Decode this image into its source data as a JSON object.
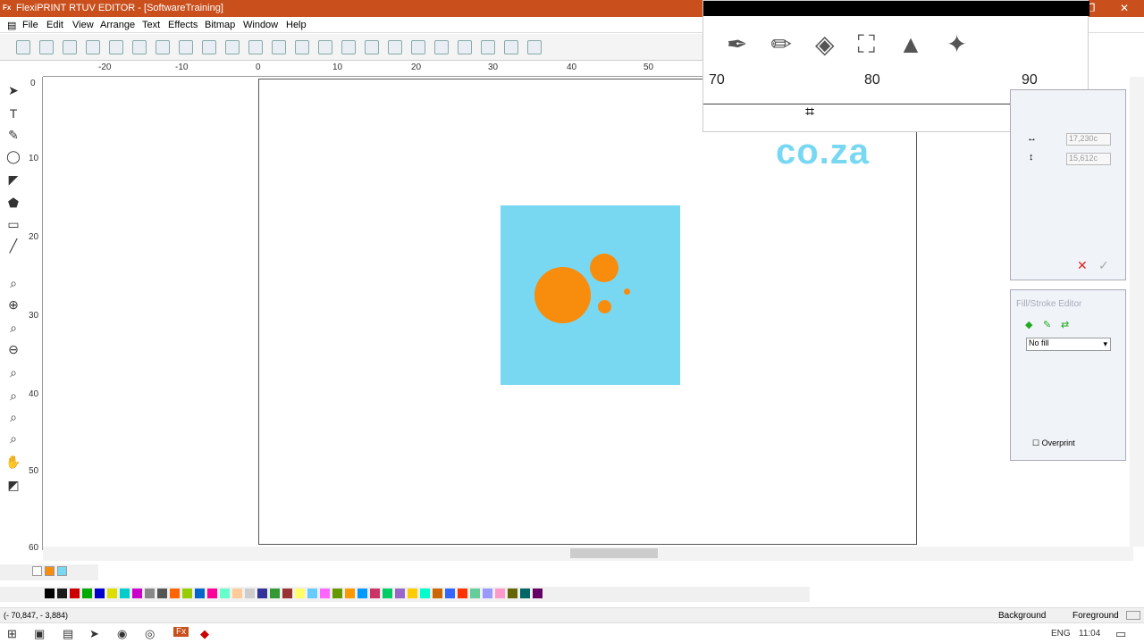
{
  "window": {
    "title": "FlexiPRINT RTUV EDITOR - [SoftwareTraining]",
    "app_icon": "Fx"
  },
  "menu": [
    "File",
    "Edit",
    "View",
    "Arrange",
    "Text",
    "Effects",
    "Bitmap",
    "Window",
    "Help"
  ],
  "ruler": {
    "h_labels": [
      "-20",
      "-10",
      "0",
      "10",
      "20",
      "30",
      "40",
      "50"
    ],
    "v_labels": [
      "0",
      "10",
      "20",
      "30",
      "40",
      "50",
      "60"
    ],
    "units": "centimeters"
  },
  "zoom_overlay": {
    "ruler_labels": [
      "70",
      "80",
      "90"
    ],
    "tool_icons": [
      "brush-icon",
      "pencil-icon",
      "fill-bucket-icon",
      "crop-icon",
      "stamp-icon",
      "magic-wand-icon"
    ]
  },
  "canvas_text": "co.za",
  "size_panel": {
    "width_value": "17,230c",
    "height_value": "15,612c"
  },
  "fill_stroke": {
    "title": "Fill/Stroke Editor",
    "fill_option": "No fill",
    "overprint_label": "Overprint"
  },
  "status": {
    "coords": "(- 70,847, - 3,884)",
    "background_label": "Background",
    "foreground_label": "Foreground"
  },
  "taskbar": {
    "lang": "ENG",
    "time": "11:04"
  },
  "colors": {
    "title_bar": "#c94f1c",
    "graphic_bg": "#78d8f2",
    "circles": "#f88c0c"
  },
  "palette_colors": [
    "#000000",
    "#1a1a1a",
    "#cc0000",
    "#00aa00",
    "#0000cc",
    "#dddd00",
    "#00cccc",
    "#cc00cc",
    "#888888",
    "#555555",
    "#ff6600",
    "#99cc00",
    "#0066cc",
    "#ff0099",
    "#66ffcc",
    "#ffcc99",
    "#cccccc",
    "#333399",
    "#339933",
    "#993333",
    "#ffff66",
    "#66ccff",
    "#ff66ff",
    "#669900",
    "#ff9900",
    "#0099ff",
    "#cc3366",
    "#00cc66",
    "#9966cc",
    "#ffcc00",
    "#00ffcc",
    "#cc6600",
    "#3366ff",
    "#ff3300",
    "#66cc99",
    "#9999ff",
    "#ff99cc",
    "#666600",
    "#006666",
    "#660066"
  ]
}
